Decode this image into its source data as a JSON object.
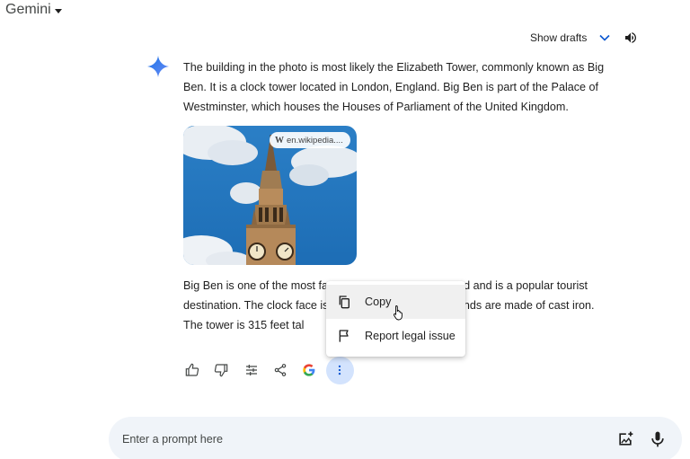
{
  "header": {
    "app_title": "Gemini"
  },
  "response": {
    "show_drafts_label": "Show drafts",
    "paragraph_1": "The building in the photo is most likely the Elizabeth Tower, commonly known as Big Ben. It is a clock tower located in London, England. Big Ben is part of the Palace of Westminster, which houses the Houses of Parliament of the United Kingdom.",
    "image_source": "en.wikipedia....",
    "paragraph_2_visible": "Big Ben is one of the most fa            d and is a popular tourist destination. The clock face is          e hands are made of cast iron. The tower is 315 feet tal"
  },
  "actions": {
    "icons": [
      "thumbs-up-icon",
      "thumbs-down-icon",
      "modify-response-icon",
      "share-icon",
      "google-icon",
      "more-vert-icon"
    ]
  },
  "context_menu": {
    "items": [
      {
        "label": "Copy",
        "icon": "copy-icon"
      },
      {
        "label": "Report legal issue",
        "icon": "flag-icon"
      }
    ]
  },
  "prompt_bar": {
    "placeholder": "Enter a prompt here"
  },
  "colors": {
    "accent_blue": "#0b57d0",
    "prompt_bg": "#f0f4f9",
    "more_button_bg": "#d3e3fd"
  }
}
